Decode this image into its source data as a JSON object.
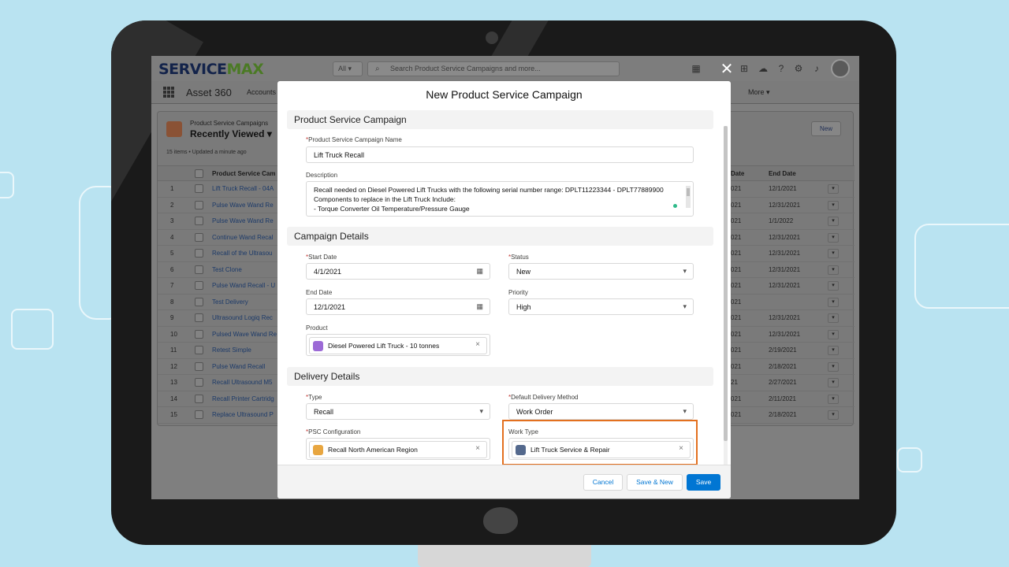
{
  "app": {
    "logo_service": "SERVICE",
    "logo_max": "MAX",
    "search_scope": "All",
    "search_placeholder": "Search Product Service Campaigns and more...",
    "app_name": "Asset 360",
    "nav_accounts": "Accounts",
    "nav_more": "More"
  },
  "list": {
    "object_label": "Product Service Campaigns",
    "view_name": "Recently Viewed",
    "meta": "15 items • Updated a minute ago",
    "new_button": "New",
    "columns": [
      "Product Service Cam",
      "Date",
      "End Date"
    ],
    "rows": [
      {
        "num": "1",
        "name": "Lift Truck Recall - 04A",
        "start": "021",
        "end": "12/1/2021"
      },
      {
        "num": "2",
        "name": "Pulse Wave Wand Re",
        "start": "021",
        "end": "12/31/2021"
      },
      {
        "num": "3",
        "name": "Pulse Wave Wand Re",
        "start": "021",
        "end": "1/1/2022"
      },
      {
        "num": "4",
        "name": "Continue Wand Recal",
        "start": "021",
        "end": "12/31/2021"
      },
      {
        "num": "5",
        "name": "Recall of the Ultrasou",
        "start": "021",
        "end": "12/31/2021"
      },
      {
        "num": "6",
        "name": "Test Clone",
        "start": "021",
        "end": "12/31/2021"
      },
      {
        "num": "7",
        "name": "Pulse Wand Recall - U",
        "start": "021",
        "end": "12/31/2021"
      },
      {
        "num": "8",
        "name": "Test Delivery",
        "start": "021",
        "end": ""
      },
      {
        "num": "9",
        "name": "Ultrasound Logiq Rec",
        "start": "021",
        "end": "12/31/2021"
      },
      {
        "num": "10",
        "name": "Pulsed Wave Wand Re",
        "start": "021",
        "end": "12/31/2021"
      },
      {
        "num": "11",
        "name": "Retest Simple",
        "start": "021",
        "end": "2/19/2021"
      },
      {
        "num": "12",
        "name": "Pulse Wand Recall",
        "start": "021",
        "end": "2/18/2021"
      },
      {
        "num": "13",
        "name": "Recall Ultrasound M5",
        "start": "21",
        "end": "2/27/2021"
      },
      {
        "num": "14",
        "name": "Recall Printer Cartridg",
        "start": "021",
        "end": "2/11/2021"
      },
      {
        "num": "15",
        "name": "Replace Ultrasound P",
        "start": "021",
        "end": "2/18/2021"
      }
    ]
  },
  "modal": {
    "title": "New Product Service Campaign",
    "close_glyph": "✕",
    "sections": {
      "psc": "Product Service Campaign",
      "campaign": "Campaign Details",
      "delivery": "Delivery Details"
    },
    "fields": {
      "name_label": "Product Service Campaign Name",
      "name_value": "Lift Truck Recall",
      "description_label": "Description",
      "description_lines": [
        "Recall needed on Diesel Powered Lift Trucks with the following serial number range: DPLT11223344 - DPLT77889900",
        "Components to replace in the Lift Truck Include:",
        "- Torque Converter Oil Temperature/Pressure Gauge"
      ],
      "start_date_label": "Start Date",
      "start_date_value": "4/1/2021",
      "status_label": "Status",
      "status_value": "New",
      "end_date_label": "End Date",
      "end_date_value": "12/1/2021",
      "priority_label": "Priority",
      "priority_value": "High",
      "product_label": "Product",
      "product_value": "Diesel Powered Lift Truck - 10 tonnes",
      "type_label": "Type",
      "type_value": "Recall",
      "delivery_method_label": "Default Delivery Method",
      "delivery_method_value": "Work Order",
      "psc_config_label": "PSC Configuration",
      "psc_config_value": "Recall North American Region",
      "work_type_label": "Work Type",
      "work_type_value": "Lift Truck Service & Repair"
    },
    "buttons": {
      "cancel": "Cancel",
      "save_new": "Save & New",
      "save": "Save"
    }
  },
  "colors": {
    "brand_primary": "#0176d3",
    "highlight_border": "#e3701f",
    "required": "#c23934",
    "product_icon": "#9c6ad6",
    "psc_icon": "#e8a640",
    "work_type_icon": "#54698d"
  }
}
